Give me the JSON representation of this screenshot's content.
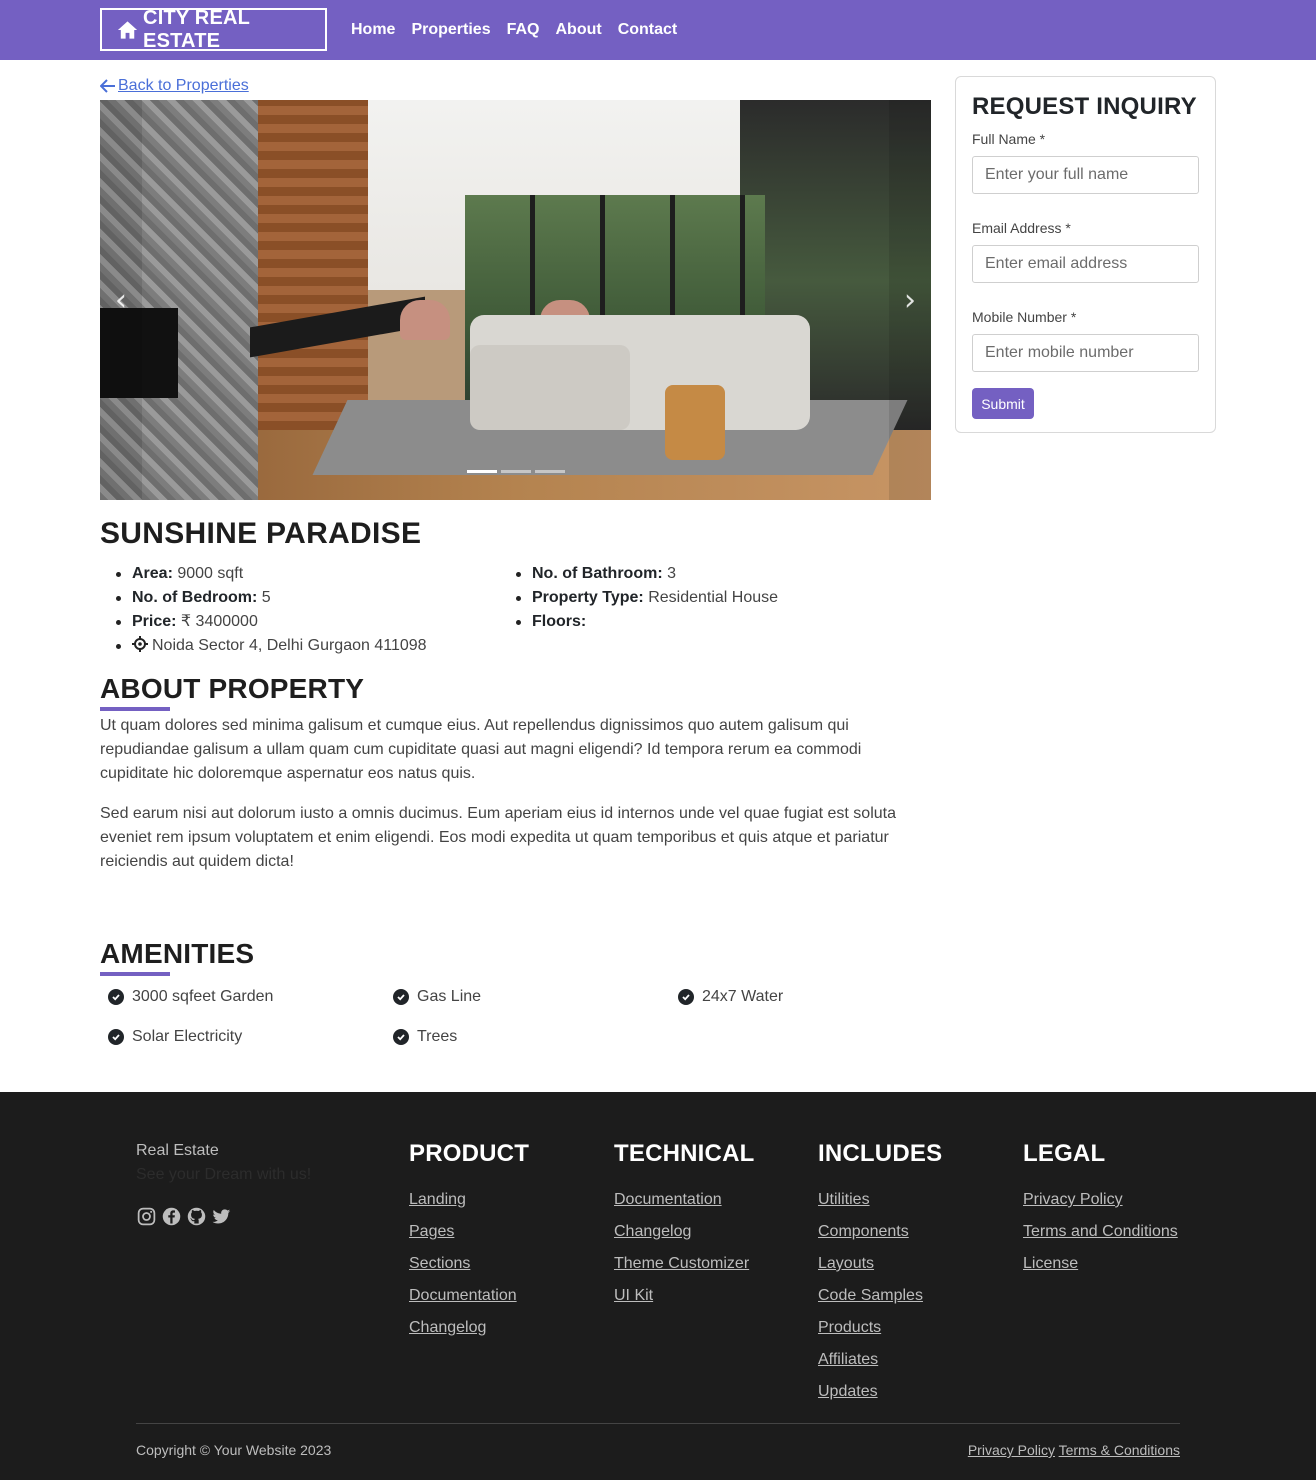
{
  "nav": {
    "brand": "CITY REAL ESTATE",
    "brand_icon": "home-icon",
    "links": [
      "Home",
      "Properties",
      "FAQ",
      "About",
      "Contact"
    ],
    "accent_color": "#7460c2"
  },
  "back_link": "Back to Properties",
  "carousel": {
    "slide_count": 3,
    "active_slide": 1,
    "prev_icon": "chevron-left-icon",
    "next_icon": "chevron-right-icon"
  },
  "inquiry": {
    "title": "REQUEST INQUIRY",
    "full_name_label": "Full Name *",
    "full_name_placeholder": "Enter your full name",
    "email_label": "Email Address *",
    "email_placeholder": "Enter email address",
    "mobile_label": "Mobile Number *",
    "mobile_placeholder": "Enter mobile number",
    "submit_label": "Submit"
  },
  "property": {
    "title": "SUNSHINE PARADISE",
    "area_label": "Area:",
    "area_value": "9000 sqft",
    "bedroom_label": "No. of Bedroom:",
    "bedroom_value": "5",
    "price_label": "Price:",
    "price_value": "₹ 3400000",
    "location": "Noida Sector 4, Delhi Gurgaon 411098",
    "bathroom_label": "No. of Bathroom:",
    "bathroom_value": "3",
    "type_label": "Property Type:",
    "type_value": "Residential House",
    "floors_label": "Floors:",
    "floors_value": ""
  },
  "about": {
    "title": "ABOUT PROPERTY",
    "para1": "Ut quam dolores sed minima galisum et cumque eius. Aut repellendus dignissimos quo autem galisum qui repudiandae galisum a ullam quam cum cupiditate quasi aut magni eligendi? Id tempora rerum ea commodi cupiditate hic doloremque aspernatur eos natus quis.",
    "para2": "Sed earum nisi aut dolorum iusto a omnis ducimus. Eum aperiam eius id internos unde vel quae fugiat est soluta eveniet rem ipsum voluptatem et enim eligendi. Eos modi expedita ut quam temporibus et quis atque et pariatur reiciendis aut quidem dicta!"
  },
  "amenities": {
    "title": "AMENITIES",
    "items": [
      "3000 sqfeet Garden",
      "Gas Line",
      "24x7 Water",
      "Solar Electricity",
      "Trees"
    ]
  },
  "footer": {
    "brand": "Real Estate",
    "tagline": "See your Dream with us!",
    "social": [
      "instagram-icon",
      "facebook-icon",
      "github-icon",
      "twitter-icon"
    ],
    "product": {
      "title": "PRODUCT",
      "links": [
        "Landing",
        "Pages",
        "Sections",
        "Documentation",
        "Changelog"
      ]
    },
    "technical": {
      "title": "TECHNICAL",
      "links": [
        "Documentation",
        "Changelog",
        "Theme Customizer",
        "UI Kit"
      ]
    },
    "includes": {
      "title": "INCLUDES",
      "links": [
        "Utilities",
        "Components",
        "Layouts",
        "Code Samples",
        "Products",
        "Affiliates",
        "Updates"
      ]
    },
    "legal": {
      "title": "LEGAL",
      "links": [
        "Privacy Policy",
        "Terms and Conditions",
        "License"
      ]
    },
    "copyright": "Copyright © Your Website 2023",
    "bottom_privacy": "Privacy Policy",
    "bottom_terms": "Terms & Conditions"
  }
}
